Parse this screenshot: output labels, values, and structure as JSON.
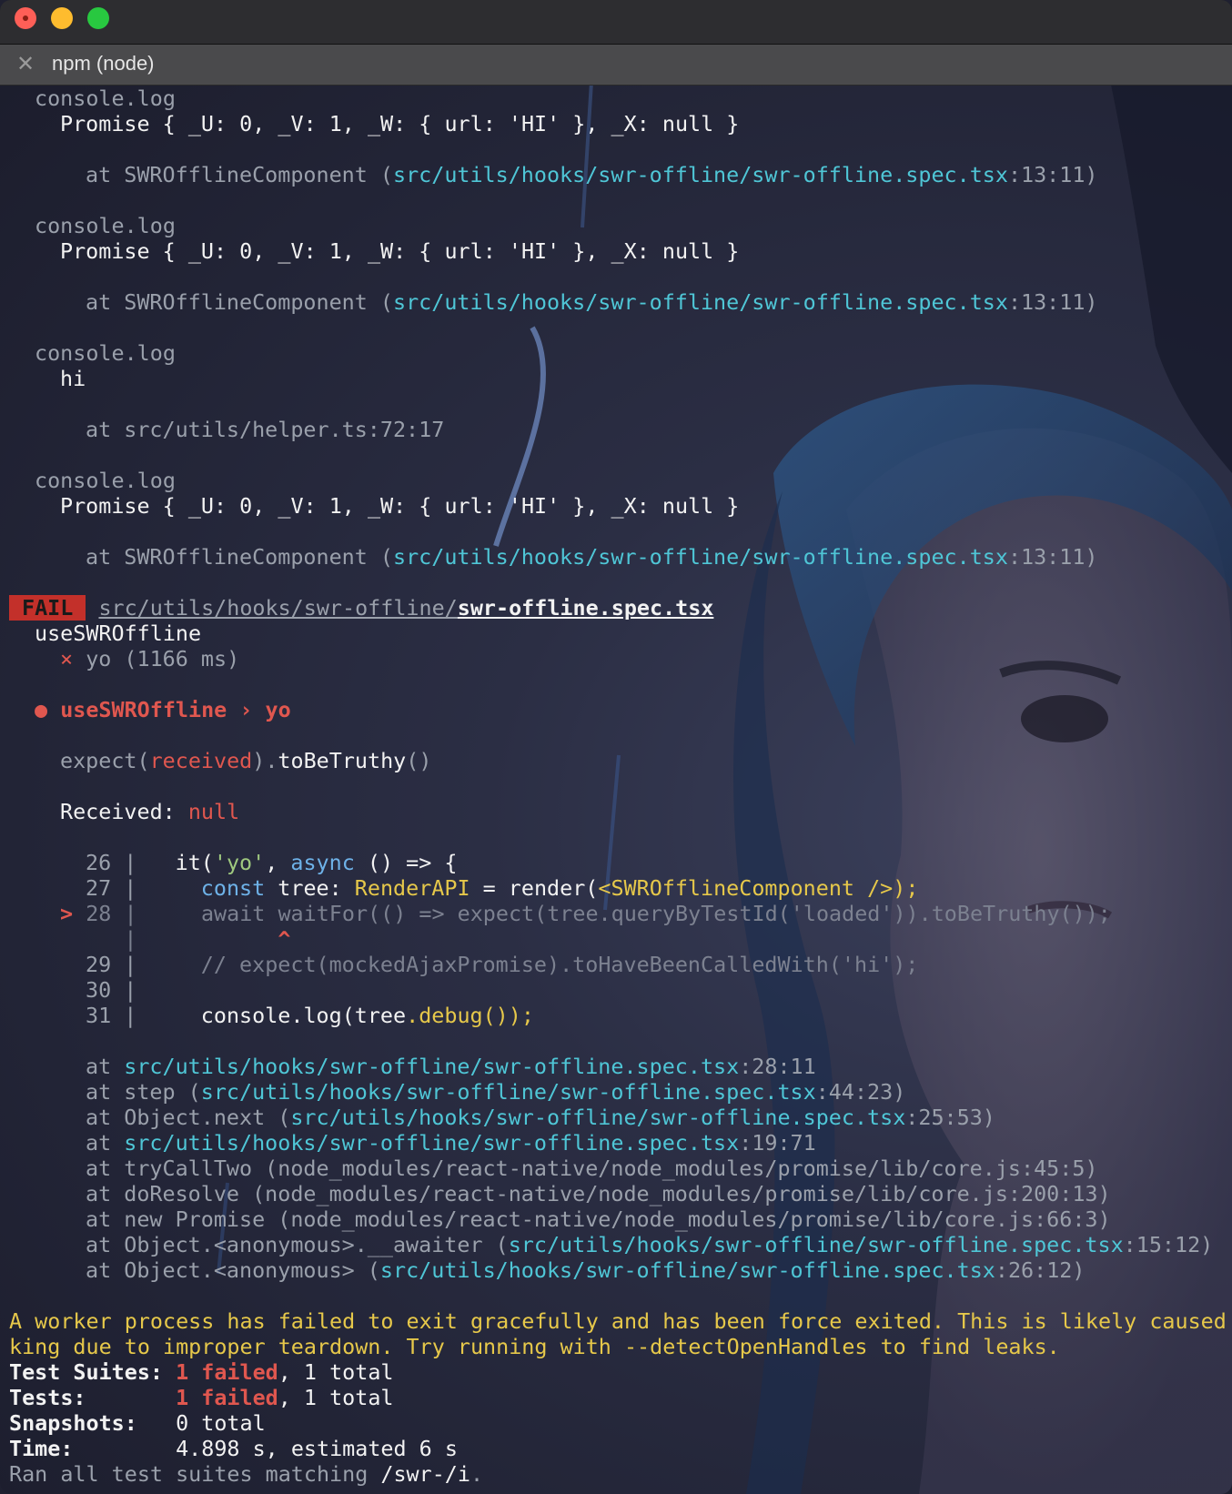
{
  "window": {
    "tab_title": "npm (node)"
  },
  "log_blocks": [
    {
      "label": "console.log",
      "value": "Promise { _U: 0, _V: 1, _W: { url: 'HI' }, _X: null }",
      "at": "at SWROfflineComponent (",
      "path": "src/utils/hooks/swr-offline/swr-offline.spec.tsx",
      "loc": ":13:11)"
    },
    {
      "label": "console.log",
      "value": "Promise { _U: 0, _V: 1, _W: { url: 'HI' }, _X: null }",
      "at": "at SWROfflineComponent (",
      "path": "src/utils/hooks/swr-offline/swr-offline.spec.tsx",
      "loc": ":13:11)"
    },
    {
      "label": "console.log",
      "value": "hi",
      "at": "at src/utils/helper.ts:72:17",
      "path": "",
      "loc": ""
    },
    {
      "label": "console.log",
      "value": "Promise { _U: 0, _V: 1, _W: { url: 'HI' }, _X: null }",
      "at": "at SWROfflineComponent (",
      "path": "src/utils/hooks/swr-offline/swr-offline.spec.tsx",
      "loc": ":13:11)"
    }
  ],
  "result": {
    "status": "FAIL",
    "dir": "src/utils/hooks/swr-offline/",
    "file": "swr-offline.spec.tsx",
    "suite": "useSWROffline",
    "test_mark": "×",
    "test_name": "yo (1166 ms)",
    "header_bullet": "●",
    "header_suite": "useSWROffline",
    "header_sep": "›",
    "header_test": "yo",
    "expect_pre": "expect(",
    "expect_received": "received",
    "expect_mid": ").",
    "expect_matcher": "toBeTruthy",
    "expect_post": "()",
    "received_label": "Received: ",
    "received_value": "null"
  },
  "code": {
    "l26_num": "26",
    "l26_a": "it(",
    "l26_str": "'yo'",
    "l26_b": ", ",
    "l26_kw": "async",
    "l26_c": " () => {",
    "l27_num": "27",
    "l27_kw": "const",
    "l27_a": " tree: ",
    "l27_type": "RenderAPI",
    "l27_b": " = render(",
    "l27_jsx": "<SWROfflineComponent />",
    "l27_c": ");",
    "l28_marker": ">",
    "l28_num": "28",
    "l28_kw": "await",
    "l28_a": " waitFor(() => expect(tree.queryByTestId(",
    "l28_str": "'loaded'",
    "l28_b": ")).toBeTruthy());",
    "caret": "^",
    "l29_num": "29",
    "l29_comment": "// expect(mockedAjaxPromise).toHaveBeenCalledWith('hi');",
    "l30_num": "30",
    "l31_num": "31",
    "l31_a": "console",
    "l31_b": ".log(tree",
    "l31_c": ".debug());",
    "pipe": "|"
  },
  "stack": [
    {
      "pre": "at ",
      "path": "src/utils/hooks/swr-offline/swr-offline.spec.tsx",
      "post": ":28:11"
    },
    {
      "pre": "at step (",
      "path": "src/utils/hooks/swr-offline/swr-offline.spec.tsx",
      "post": ":44:23)"
    },
    {
      "pre": "at Object.next (",
      "path": "src/utils/hooks/swr-offline/swr-offline.spec.tsx",
      "post": ":25:53)"
    },
    {
      "pre": "at ",
      "path": "src/utils/hooks/swr-offline/swr-offline.spec.tsx",
      "post": ":19:71"
    },
    {
      "pre": "at tryCallTwo (node_modules/react-native/node_modules/promise/lib/core.js:45:5)",
      "path": "",
      "post": ""
    },
    {
      "pre": "at doResolve (node_modules/react-native/node_modules/promise/lib/core.js:200:13)",
      "path": "",
      "post": ""
    },
    {
      "pre": "at new Promise (node_modules/react-native/node_modules/promise/lib/core.js:66:3)",
      "path": "",
      "post": ""
    },
    {
      "pre": "at Object.<anonymous>.__awaiter (",
      "path": "src/utils/hooks/swr-offline/swr-offline.spec.tsx",
      "post": ":15:12)"
    },
    {
      "pre": "at Object.<anonymous> (",
      "path": "src/utils/hooks/swr-offline/swr-offline.spec.tsx",
      "post": ":26:12)"
    }
  ],
  "warning": {
    "line1": "A worker process has failed to exit gracefully and has been force exited. This is likely caused",
    "line2": "king due to improper teardown. Try running with --detectOpenHandles to find leaks."
  },
  "summary": {
    "suites_label": "Test Suites:",
    "suites_failed": "1 failed",
    "suites_total": ", 1 total",
    "tests_label": "Tests:",
    "tests_failed": "1 failed",
    "tests_total": ", 1 total",
    "snapshots_label": "Snapshots:",
    "snapshots_value": "0 total",
    "time_label": "Time:",
    "time_value": "4.898 s, estimated 6 s",
    "ran_text": "Ran all test suites matching ",
    "ran_pattern": "/swr-/i",
    "ran_end": "."
  }
}
